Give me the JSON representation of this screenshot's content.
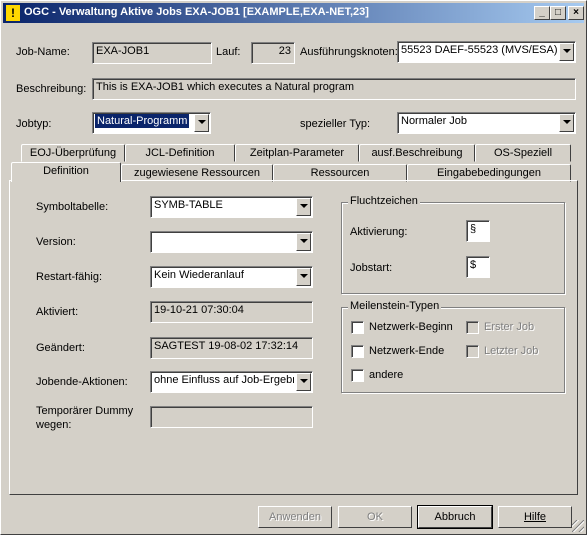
{
  "window": {
    "icon": "!",
    "title": "OGC - Verwaltung Aktive Jobs EXA-JOB1 [EXAMPLE,EXA-NET,23]",
    "controls": {
      "minimize": "_",
      "maximize": "□",
      "close": "×"
    }
  },
  "header": {
    "job_name_label": "Job-Name:",
    "job_name_value": "EXA-JOB1",
    "lauf_label": "Lauf:",
    "lauf_value": "23",
    "node_label": "Ausführungsknoten:",
    "node_value": "55523  DAEF-55523 (MVS/ESA)",
    "description_label": "Beschreibung:",
    "description_value": "This is EXA-JOB1 which executes a Natural program",
    "jobtyp_label": "Jobtyp:",
    "jobtyp_value": "Natural-Programm",
    "special_type_label": "spezieller Typ:",
    "special_type_value": "Normaler Job"
  },
  "tabs": {
    "row_back": [
      "EOJ-Überprüfung",
      "JCL-Definition",
      "Zeitplan-Parameter",
      "ausf.Beschreibung",
      "OS-Speziell"
    ],
    "row_front": [
      "Definition",
      "zugewiesene Ressourcen",
      "Ressourcen",
      "Eingabebedingungen"
    ],
    "active": "Definition"
  },
  "definition": {
    "symboltabelle_label": "Symboltabelle:",
    "symboltabelle_value": "SYMB-TABLE",
    "version_label": "Version:",
    "version_value": "",
    "restart_label": "Restart-fähig:",
    "restart_value": "Kein Wiederanlauf",
    "aktiviert_label": "Aktiviert:",
    "aktiviert_value": "19-10-21 07:30:04",
    "geaendert_label": "Geändert:",
    "geaendert_value": "SAGTEST 19-08-02 17:32:14",
    "jobende_label": "Jobende-Aktionen:",
    "jobende_value": "ohne Einfluss auf Job-Ergebnis",
    "dummy_label_line1": "Temporärer Dummy",
    "dummy_label_line2": "wegen:",
    "dummy_value": ""
  },
  "fluchtzeichen": {
    "title": "Fluchtzeichen",
    "aktivierung_label": "Aktivierung:",
    "aktivierung_value": "§",
    "jobstart_label": "Jobstart:",
    "jobstart_value": "$"
  },
  "meilenstein": {
    "title": "Meilenstein-Typen",
    "netzwerk_beginn": "Netzwerk-Beginn",
    "netzwerk_ende": "Netzwerk-Ende",
    "andere": "andere",
    "erster_job": "Erster Job",
    "letzter_job": "Letzter Job"
  },
  "buttons": {
    "anwenden": "Anwenden",
    "ok": "OK",
    "abbruch": "Abbruch",
    "hilfe": "Hilfe"
  },
  "colors": {
    "titlebar_start": "#0a246a",
    "titlebar_end": "#a6caf0",
    "face": "#d4d0c8",
    "selection": "#0a246a"
  }
}
